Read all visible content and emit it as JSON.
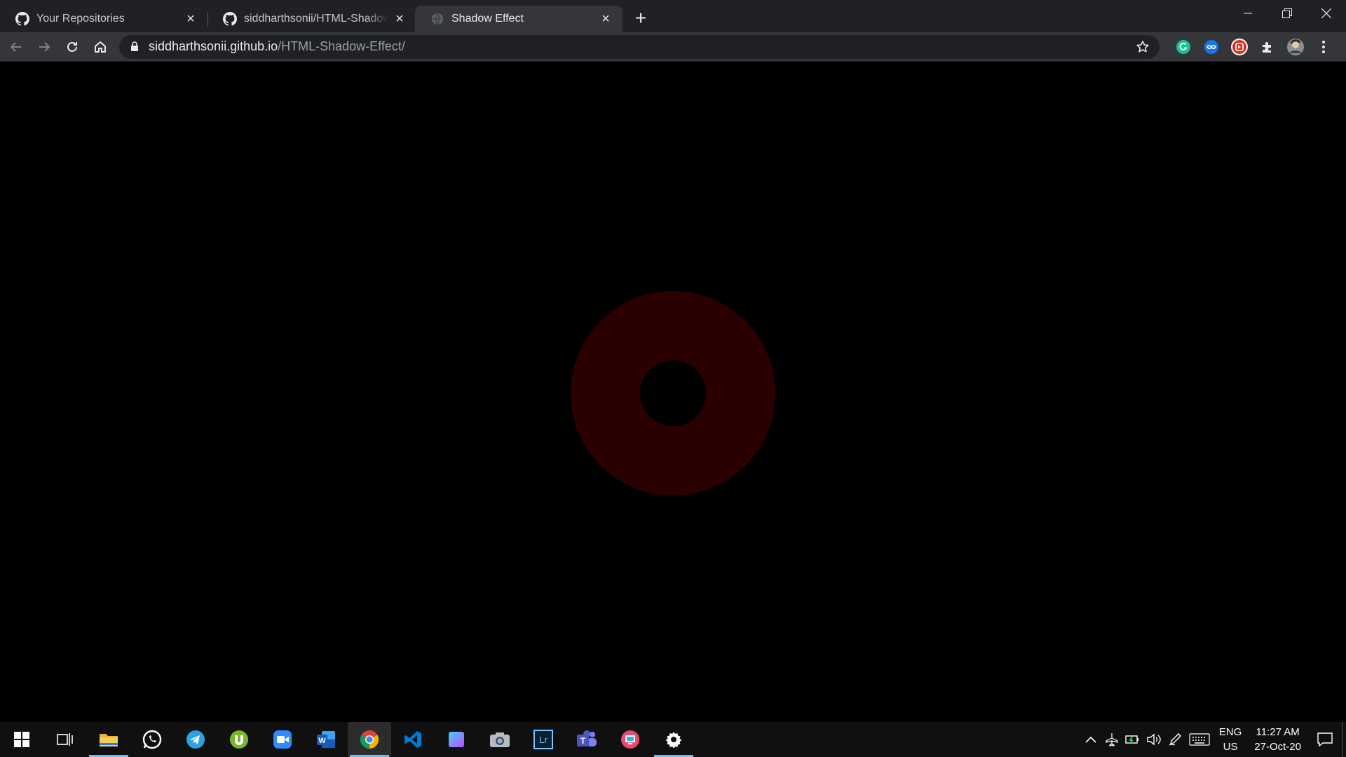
{
  "browser": {
    "tabs": [
      {
        "title": "Your Repositories",
        "icon": "github-icon",
        "active": false
      },
      {
        "title": "siddharthsonii/HTML-Shadow-Effect",
        "icon": "github-icon",
        "active": false
      },
      {
        "title": "Shadow Effect",
        "icon": "globe-icon",
        "active": true
      }
    ],
    "address": {
      "host": "siddharthsonii.github.io",
      "path": "/HTML-Shadow-Effect/"
    }
  },
  "page": {
    "donut_color": "#2a0000",
    "background": "#000000"
  },
  "taskbar": {
    "apps": [
      "windows-start",
      "task-view",
      "file-explorer",
      "whatsapp",
      "telegram",
      "utorrent",
      "zoom",
      "word",
      "chrome",
      "vscode",
      "app-square",
      "camera",
      "lightroom",
      "teams",
      "screen-app",
      "settings"
    ],
    "lang_line1": "ENG",
    "lang_line2": "US",
    "time": "11:27 AM",
    "date": "27-Oct-20"
  }
}
